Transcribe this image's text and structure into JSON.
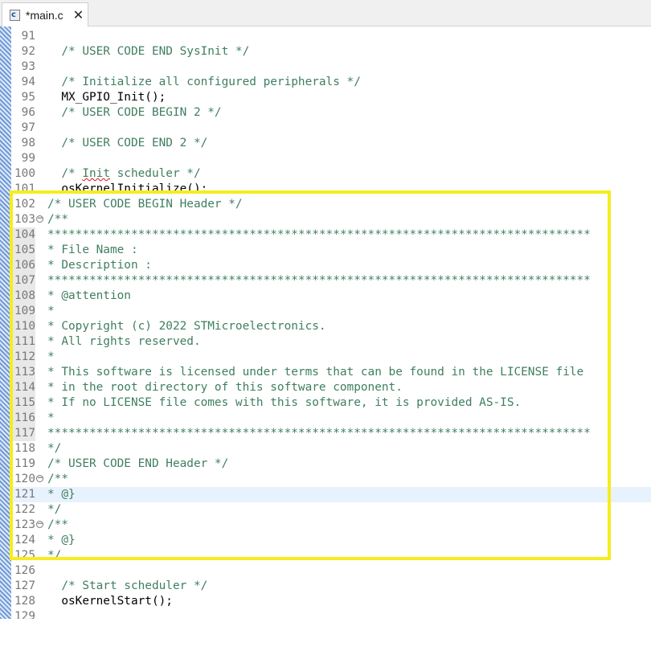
{
  "tab": {
    "title": "*main.c",
    "file_icon": "c-file-icon",
    "file_icon_letter": "c",
    "close_icon": "close-icon"
  },
  "colors": {
    "comment": "#3f7f5f",
    "highlight": "#f6ec1f",
    "current_line": "#e8f2fe"
  },
  "lines": [
    {
      "n": "91",
      "text": ""
    },
    {
      "n": "92",
      "text": "  /* USER CODE END SysInit */"
    },
    {
      "n": "93",
      "text": ""
    },
    {
      "n": "94",
      "text": "  /* Initialize all configured peripherals */"
    },
    {
      "n": "95",
      "text": "  MX_GPIO_Init();"
    },
    {
      "n": "96",
      "text": "  /* USER CODE BEGIN 2 */"
    },
    {
      "n": "97",
      "text": ""
    },
    {
      "n": "98",
      "text": "  /* USER CODE END 2 */"
    },
    {
      "n": "99",
      "text": ""
    },
    {
      "n": "100",
      "text_a": "  /* ",
      "text_b": "Init",
      "text_c": " scheduler */"
    },
    {
      "n": "101",
      "text": "  osKernelInitialize();"
    },
    {
      "n": "102",
      "text": "/* USER CODE BEGIN Header */"
    },
    {
      "n": "103",
      "text": "/**"
    },
    {
      "n": "104",
      "text": "******************************************************************************"
    },
    {
      "n": "105",
      "text": "* File Name :"
    },
    {
      "n": "106",
      "text": "* Description :"
    },
    {
      "n": "107",
      "text": "******************************************************************************"
    },
    {
      "n": "108",
      "text": "* @attention"
    },
    {
      "n": "109",
      "text": "*"
    },
    {
      "n": "110",
      "text": "* Copyright (c) 2022 STMicroelectronics."
    },
    {
      "n": "111",
      "text": "* All rights reserved."
    },
    {
      "n": "112",
      "text": "*"
    },
    {
      "n": "113",
      "text": "* This software is licensed under terms that can be found in the LICENSE file"
    },
    {
      "n": "114",
      "text": "* in the root directory of this software component."
    },
    {
      "n": "115",
      "text": "* If no LICENSE file comes with this software, it is provided AS-IS."
    },
    {
      "n": "116",
      "text": "*"
    },
    {
      "n": "117",
      "text": "******************************************************************************"
    },
    {
      "n": "118",
      "text": "*/"
    },
    {
      "n": "119",
      "text": "/* USER CODE END Header */"
    },
    {
      "n": "120",
      "text": "/**"
    },
    {
      "n": "121",
      "text": "* @}"
    },
    {
      "n": "122",
      "text": "*/"
    },
    {
      "n": "123",
      "text": "/**"
    },
    {
      "n": "124",
      "text": "* @}"
    },
    {
      "n": "125",
      "text": "*/"
    },
    {
      "n": "126",
      "text": ""
    },
    {
      "n": "127",
      "text": "  /* Start scheduler */"
    },
    {
      "n": "128",
      "text": "  osKernelStart();"
    },
    {
      "n": "129",
      "text": ""
    }
  ]
}
